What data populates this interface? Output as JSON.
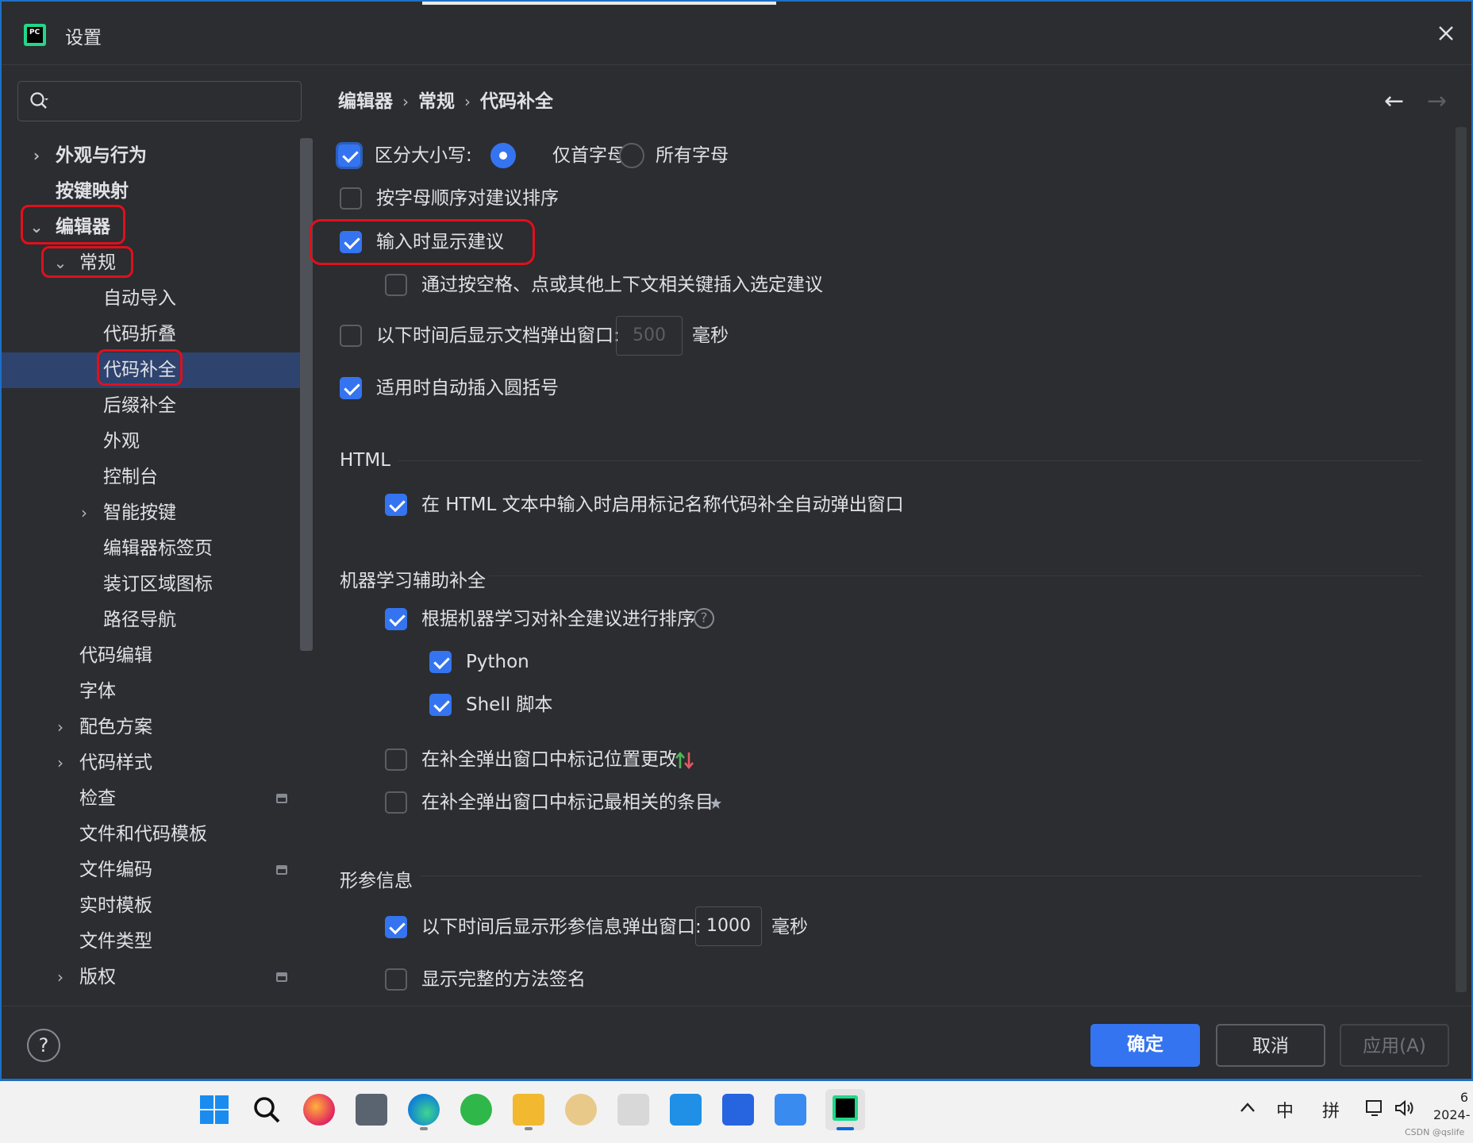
{
  "window": {
    "title": "设置"
  },
  "sidebar": {
    "search": {
      "placeholder": ""
    },
    "items": [
      {
        "label": "外观与行为"
      },
      {
        "label": "按键映射"
      },
      {
        "label": "编辑器"
      },
      {
        "label": "常规"
      },
      {
        "label": "自动导入"
      },
      {
        "label": "代码折叠"
      },
      {
        "label": "代码补全"
      },
      {
        "label": "后缀补全"
      },
      {
        "label": "外观"
      },
      {
        "label": "控制台"
      },
      {
        "label": "智能按键"
      },
      {
        "label": "编辑器标签页"
      },
      {
        "label": "装订区域图标"
      },
      {
        "label": "路径导航"
      },
      {
        "label": "代码编辑"
      },
      {
        "label": "字体"
      },
      {
        "label": "配色方案"
      },
      {
        "label": "代码样式"
      },
      {
        "label": "检查"
      },
      {
        "label": "文件和代码模板"
      },
      {
        "label": "文件编码"
      },
      {
        "label": "实时模板"
      },
      {
        "label": "文件类型"
      },
      {
        "label": "版权"
      }
    ],
    "selected": "代码补全"
  },
  "breadcrumb": [
    "编辑器",
    "常规",
    "代码补全"
  ],
  "options": {
    "case_sensitive": {
      "label": "区分大小写:",
      "checked": true
    },
    "case_first_letter": {
      "label": "仅首字母",
      "selected": true
    },
    "case_all_letters": {
      "label": "所有字母",
      "selected": false
    },
    "sort_alpha": {
      "label": "按字母顺序对建议排序",
      "checked": false
    },
    "show_on_typing": {
      "label": "输入时显示建议",
      "checked": true
    },
    "insert_by_space": {
      "label": "通过按空格、点或其他上下文相关键插入选定建议",
      "checked": false
    },
    "doc_popup": {
      "label": "以下时间后显示文档弹出窗口:",
      "checked": false,
      "value": "500",
      "unit": "毫秒"
    },
    "auto_parens": {
      "label": "适用时自动插入圆括号",
      "checked": true
    }
  },
  "html_section": {
    "title": "HTML",
    "tag_popup": {
      "label": "在 HTML 文本中输入时启用标记名称代码补全自动弹出窗口",
      "checked": true
    }
  },
  "ml_section": {
    "title": "机器学习辅助补全",
    "sort_ml": {
      "label": "根据机器学习对补全建议进行排序",
      "checked": true,
      "help": "?"
    },
    "python": {
      "label": "Python",
      "checked": true
    },
    "shell": {
      "label": "Shell 脚本",
      "checked": true
    },
    "mark_position": {
      "label": "在补全弹出窗口中标记位置更改",
      "checked": false
    },
    "mark_relevant": {
      "label": "在补全弹出窗口中标记最相关的条目",
      "checked": false
    }
  },
  "param_section": {
    "title": "形参信息",
    "param_popup": {
      "label": "以下时间后显示形参信息弹出窗口:",
      "checked": true,
      "value": "1000",
      "unit": "毫秒"
    },
    "full_signature": {
      "label": "显示完整的方法签名",
      "checked": false
    }
  },
  "footer": {
    "help": "?",
    "ok": "确定",
    "cancel": "取消",
    "apply": "应用(A)"
  },
  "taskbar": {
    "tray": {
      "ime_lang": "中",
      "ime_mode": "拼"
    },
    "clock": {
      "time": "6",
      "date": "2024-"
    },
    "watermark": "CSDN @qslife"
  },
  "colors": {
    "accent": "#3574f0",
    "annotation": "#e0101c",
    "selection": "#2e436e",
    "background": "#2b2d30"
  }
}
